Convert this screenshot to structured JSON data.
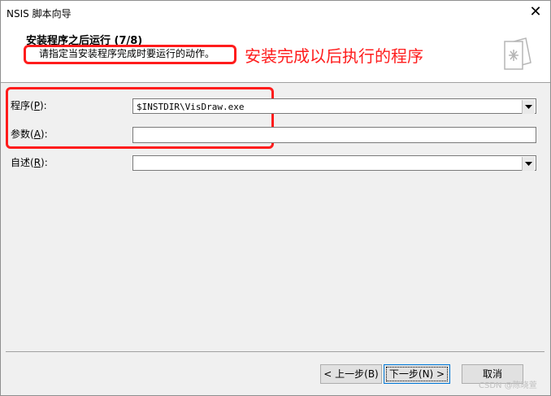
{
  "window": {
    "title": "NSIS 脚本向导",
    "close_glyph": "✕"
  },
  "header": {
    "heading": "安装程序之后运行 (7/8)",
    "subtitle": "请指定当安装程序完成时要运行的动作。",
    "annotation": "安装完成以后执行的程序",
    "icon": "wizard-page-icon"
  },
  "fields": {
    "program": {
      "label": "程序",
      "accel": "P",
      "value": "$INSTDIR\\VisDraw.exe"
    },
    "params": {
      "label": "参数",
      "accel": "A",
      "value": ""
    },
    "readme": {
      "label": "自述",
      "accel": "R",
      "value": ""
    }
  },
  "buttons": {
    "back": "< 上一步(B)",
    "next": "下一步(N) >",
    "cancel": "取消"
  },
  "watermark": "CSDN @陈晓萱",
  "colors": {
    "annotation_red": "#ff1c1c",
    "default_button_border": "#0078d7"
  }
}
